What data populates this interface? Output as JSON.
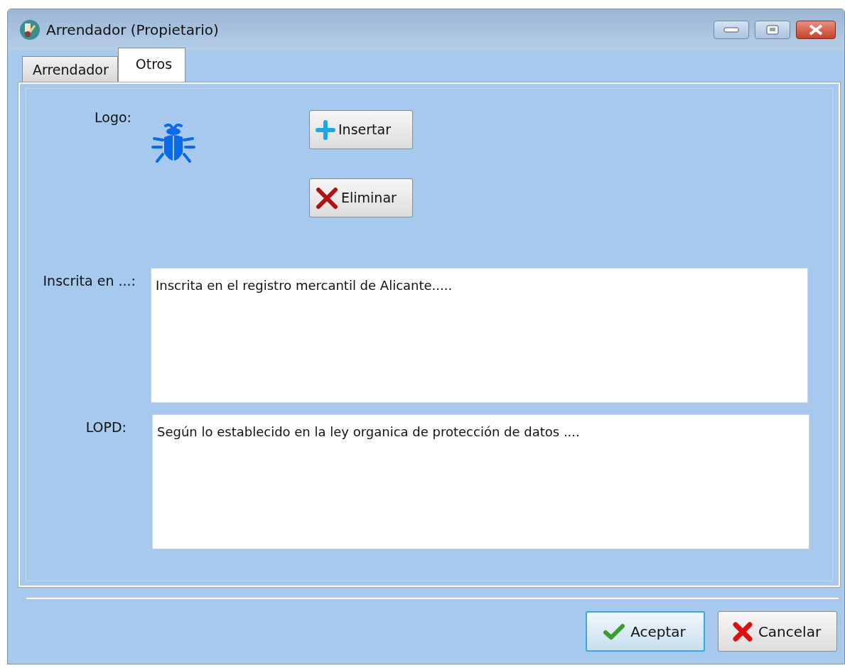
{
  "window": {
    "title": "Arrendador (Propietario)"
  },
  "tabs": [
    {
      "label": "Arrendador",
      "selected": false
    },
    {
      "label": "Otros",
      "selected": true
    }
  ],
  "logo": {
    "label": "Logo:"
  },
  "logo_buttons": [
    {
      "label": "Insertar",
      "kind": "plus"
    },
    {
      "label": "Eliminar",
      "kind": "cross"
    }
  ],
  "fields": [
    {
      "label": "Inscrita en ...:",
      "value": "Inscrita en el registro mercantil de Alicante....."
    },
    {
      "label": "LOPD:",
      "value": "Según lo establecido en la ley organica de protección de datos ...."
    }
  ],
  "footer_buttons": [
    {
      "label": "Aceptar",
      "kind": "check",
      "default": true
    },
    {
      "label": "Cancelar",
      "kind": "bigcross",
      "default": false
    }
  ]
}
